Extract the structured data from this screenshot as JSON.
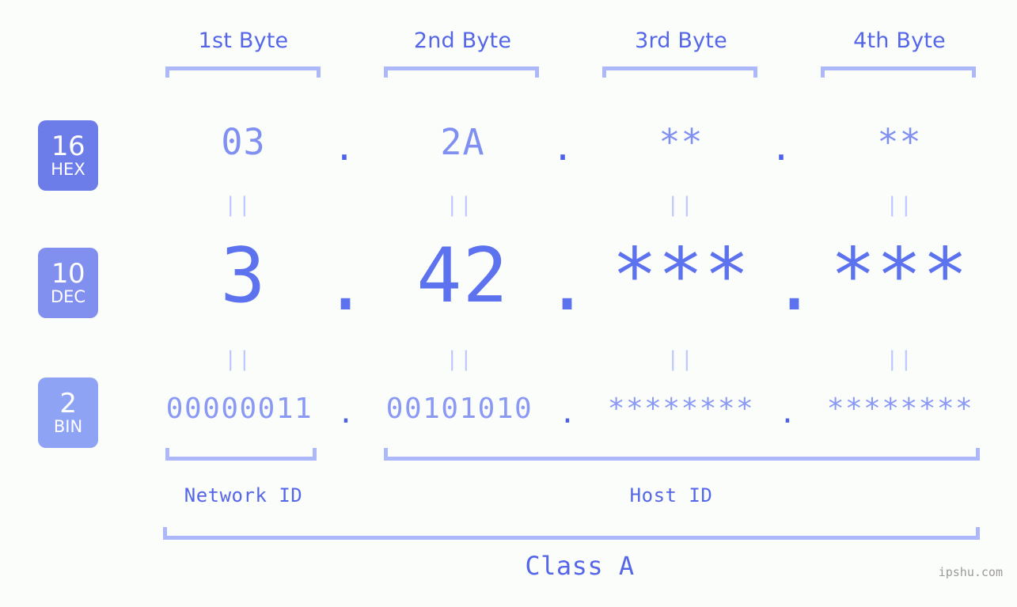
{
  "background_color": "#fbfdfa",
  "accent_color": "#5566e8",
  "bracket_color": "#adb8fb",
  "byte_headers": [
    {
      "label": "1st Byte"
    },
    {
      "label": "2nd Byte"
    },
    {
      "label": "3rd Byte"
    },
    {
      "label": "4th Byte"
    }
  ],
  "radix_badges": [
    {
      "number": "16",
      "abbr": "HEX",
      "color": "#6c7ce8"
    },
    {
      "number": "10",
      "abbr": "DEC",
      "color": "#8190ef"
    },
    {
      "number": "2",
      "abbr": "BIN",
      "color": "#8fa3f5"
    }
  ],
  "rows": {
    "hex": {
      "values": [
        "03",
        "2A",
        "**",
        "**"
      ],
      "separators": [
        ".",
        ".",
        "."
      ]
    },
    "dec": {
      "values": [
        "3",
        "42",
        "***",
        "***"
      ],
      "separators": [
        ".",
        ".",
        "."
      ]
    },
    "bin": {
      "values": [
        "00000011",
        "00101010",
        "********",
        "********"
      ],
      "separators": [
        ".",
        ".",
        "."
      ]
    }
  },
  "equality_marks": {
    "symbol": "||",
    "count_per_row": 4
  },
  "segments": {
    "network_id": "Network ID",
    "host_id": "Host ID",
    "class": "Class A"
  },
  "watermark": "ipshu.com"
}
